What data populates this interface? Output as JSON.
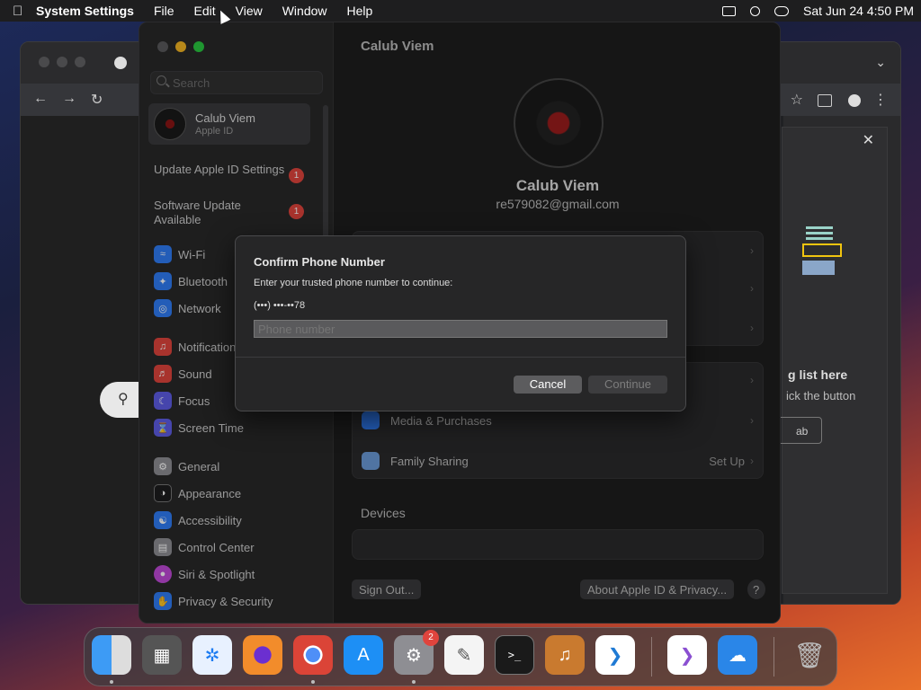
{
  "menubar": {
    "app_name": "System Settings",
    "items": [
      "File",
      "Edit",
      "View",
      "Window",
      "Help"
    ],
    "clock": "Sat Jun 24  4:50 PM"
  },
  "chrome": {
    "right_heading": "g list here",
    "right_sub": "ick the button",
    "right_button": "ab"
  },
  "settings": {
    "search_placeholder": "Search",
    "account": {
      "name": "Calub Viem",
      "subtitle": "Apple ID"
    },
    "notices": [
      {
        "label": "Update Apple ID Settings",
        "badge": "1"
      },
      {
        "label": "Software Update Available",
        "badge": "1"
      }
    ],
    "sidebar": [
      {
        "label": "Wi-Fi",
        "icon": "wifi-icon",
        "color": "#2f7cf6"
      },
      {
        "label": "Bluetooth",
        "icon": "bluetooth-icon",
        "color": "#2f7cf6"
      },
      {
        "label": "Network",
        "icon": "globe-icon",
        "color": "#2f7cf6"
      },
      {
        "label": "Notifications",
        "icon": "bell-icon",
        "color": "#e0443d"
      },
      {
        "label": "Sound",
        "icon": "speaker-icon",
        "color": "#e0443d"
      },
      {
        "label": "Focus",
        "icon": "moon-icon",
        "color": "#5e5ce6"
      },
      {
        "label": "Screen Time",
        "icon": "hourglass-icon",
        "color": "#5e5ce6"
      },
      {
        "label": "General",
        "icon": "gear-icon",
        "color": "#8e8e93"
      },
      {
        "label": "Appearance",
        "icon": "appearance-icon",
        "color": "#1c1c1e"
      },
      {
        "label": "Accessibility",
        "icon": "accessibility-icon",
        "color": "#2f7cf6"
      },
      {
        "label": "Control Center",
        "icon": "control-center-icon",
        "color": "#8e8e93"
      },
      {
        "label": "Siri & Spotlight",
        "icon": "siri-icon",
        "color": "#c04ad8"
      },
      {
        "label": "Privacy & Security",
        "icon": "hand-icon",
        "color": "#2f7cf6"
      }
    ],
    "main_title": "Calub Viem",
    "profile_name": "Calub Viem",
    "profile_email": "re579082@gmail.com",
    "rows": [
      {
        "label": "Media & Purchases",
        "value": ""
      },
      {
        "label": "Family Sharing",
        "value": "Set Up"
      }
    ],
    "devices_heading": "Devices",
    "sign_out": "Sign Out...",
    "about": "About Apple ID & Privacy...",
    "help": "?"
  },
  "dialog": {
    "title": "Confirm Phone Number",
    "prompt": "Enter your trusted phone number to continue:",
    "masked_number": "(•••) •••-••78",
    "input_placeholder": "Phone number",
    "input_value": "",
    "cancel": "Cancel",
    "continue": "Continue"
  },
  "dock": {
    "apps": [
      "Finder",
      "Launchpad",
      "Safari",
      "Firefox",
      "Chrome",
      "App Store",
      "System Settings",
      "TextEdit",
      "Terminal",
      "GarageBand",
      "Visual Studio Code",
      "Visual Studio",
      "Weather",
      "Trash"
    ],
    "settings_badge": "2"
  }
}
